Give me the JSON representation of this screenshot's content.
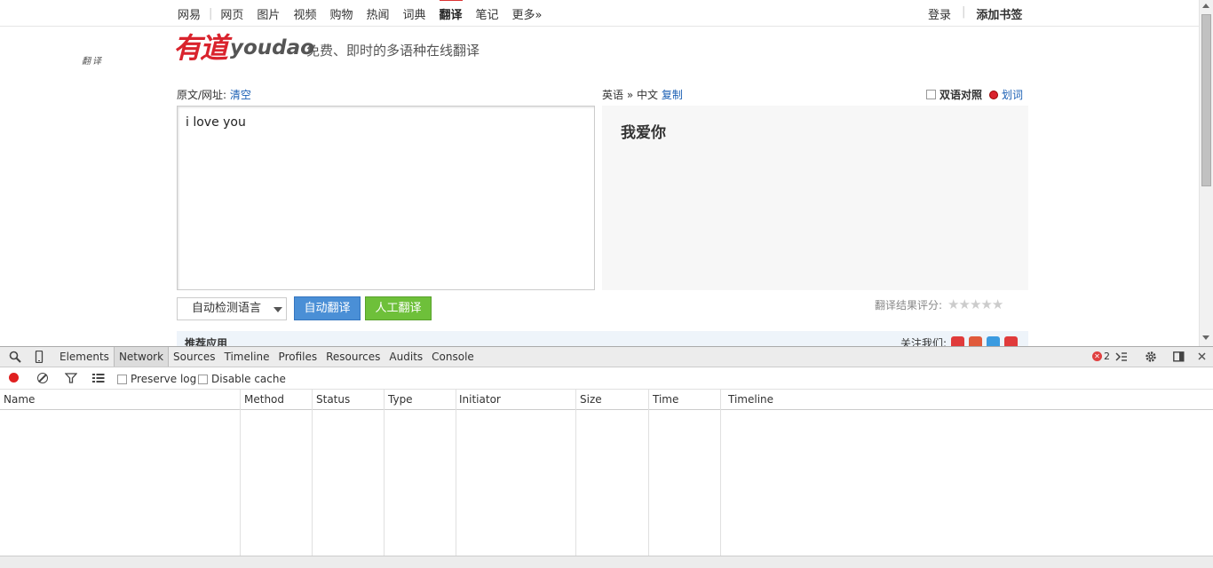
{
  "nav": {
    "items": [
      "网易",
      "网页",
      "图片",
      "视频",
      "购物",
      "热闻",
      "词典",
      "翻译",
      "笔记",
      "更多»"
    ],
    "login": "登录",
    "bookmark": "添加书签"
  },
  "logo": {
    "cn": "有道",
    "en": "youdao",
    "sub": "翻译"
  },
  "slogan": "免费、即时的多语种在线翻译",
  "source": {
    "label": "原文/网址:",
    "clear": "清空",
    "text": "i love you"
  },
  "target": {
    "from": "英语",
    "arrow": "»",
    "to": "中文",
    "copy": "复制",
    "bilingual": "双语对照",
    "lookup": "划词",
    "text": "我爱你"
  },
  "controls": {
    "lang_select": "自动检测语言",
    "auto_translate": "自动翻译",
    "human_translate": "人工翻译"
  },
  "rating": {
    "label": "翻译结果评分:",
    "stars": "★★★★★"
  },
  "recommend": {
    "title": "推荐应用",
    "follow": "关注我们:"
  },
  "devtools": {
    "tabs": [
      "Elements",
      "Network",
      "Sources",
      "Timeline",
      "Profiles",
      "Resources",
      "Audits",
      "Console"
    ],
    "error_count": "2",
    "preserve_log": "Preserve log",
    "disable_cache": "Disable cache",
    "columns": [
      "Name",
      "Method",
      "Status",
      "Type",
      "Initiator",
      "Size",
      "Time",
      "Timeline"
    ]
  }
}
